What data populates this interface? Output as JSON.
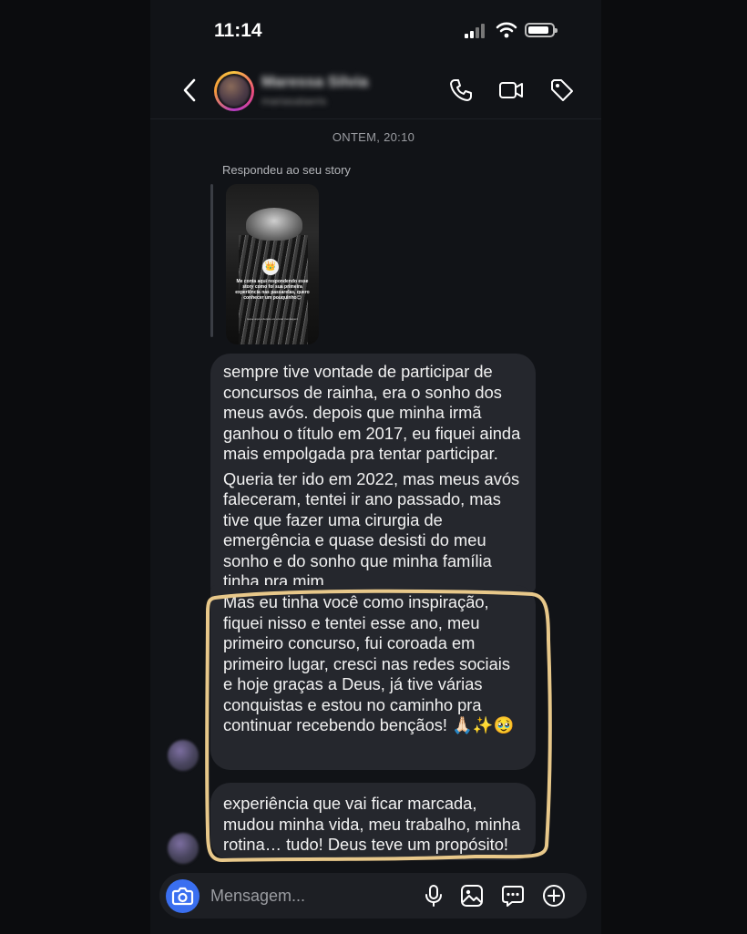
{
  "status_bar": {
    "time": "11:14"
  },
  "header": {
    "contact_name": "Maressa Silvia",
    "contact_sub": "mariasalaeris"
  },
  "chat": {
    "date_separator": "ONTEM, 20:10",
    "reply_label": "Respondeu ao seu story",
    "story": {
      "caption": "Me conta aqui respondendo esse story como foi sua primeira experiência nas passarelas, quero conhecer um pouquinho😊",
      "footer": "toque aqui e depois em enviar mensagem"
    },
    "messages": [
      {
        "paragraphs": [
          "sempre tive vontade de participar de concursos de rainha, era o sonho dos meus avós. depois que minha irmã ganhou o título em 2017, eu fiquei ainda mais empolgada pra tentar participar.",
          "Queria ter ido em 2022, mas meus avós faleceram, tentei ir ano passado, mas tive que fazer uma cirurgia de emergência e quase desisti do meu sonho e do sonho que minha família tinha pra mim."
        ]
      },
      {
        "paragraphs": [
          "Mas eu tinha você como inspiração, fiquei nisso e tentei esse ano, meu primeiro concurso, fui coroada em primeiro lugar, cresci nas redes sociais e hoje graças a Deus, já tive várias conquistas e estou no caminho pra continuar recebendo bençãos! 🙏🏻✨🥹"
        ]
      },
      {
        "paragraphs": [
          "experiência que vai ficar marcada, mudou minha vida, meu trabalho, minha rotina… tudo! Deus teve um propósito!"
        ]
      }
    ]
  },
  "composer": {
    "placeholder": "Mensagem..."
  },
  "icons": {
    "back": "chevron-left-icon",
    "call": "phone-icon",
    "video": "video-camera-icon",
    "tag": "tag-icon",
    "camera": "camera-icon",
    "mic": "microphone-icon",
    "gallery": "image-icon",
    "sticker": "chat-bubble-icon",
    "add": "plus-circle-icon"
  },
  "colors": {
    "background": "#111317",
    "bubble": "#25272d",
    "accent": "#3a6ff0",
    "highlight": "#e8c88a"
  }
}
